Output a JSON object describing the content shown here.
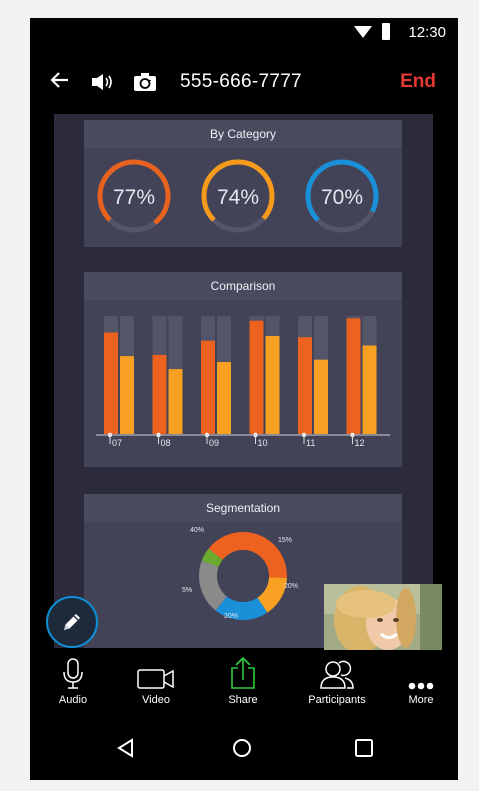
{
  "status": {
    "time": "12:30"
  },
  "call": {
    "phone_number": "555-666-7777",
    "end_label": "End"
  },
  "cards": {
    "category": {
      "title": "By Category",
      "gauges": [
        {
          "label": "77%",
          "value": 77,
          "color": "#e8621f"
        },
        {
          "label": "74%",
          "value": 74,
          "color": "#f59a1b"
        },
        {
          "label": "70%",
          "value": 70,
          "color": "#1a90d9"
        }
      ]
    },
    "comparison": {
      "title": "Comparison"
    },
    "segmentation": {
      "title": "Segmentation"
    }
  },
  "chart_data": [
    {
      "type": "bar",
      "title": "Comparison",
      "categories": [
        "07",
        "08",
        "09",
        "10",
        "11",
        "12"
      ],
      "series": [
        {
          "values": [
            86,
            67,
            79,
            96,
            82,
            98
          ],
          "color": "#ee6220"
        },
        {
          "values": [
            66,
            55,
            61,
            83,
            63,
            75
          ],
          "color": "#f7a021"
        }
      ],
      "ylim": [
        0,
        100
      ]
    },
    {
      "type": "pie",
      "title": "Segmentation",
      "labels": [
        "40%",
        "15%",
        "20%",
        "20%",
        "5%"
      ],
      "values": [
        40,
        15,
        20,
        20,
        5
      ],
      "colors": [
        "#ee6220",
        "#f7a021",
        "#1a90d9",
        "#8a8a8a",
        "#6aab2e"
      ]
    }
  ],
  "toolbar": {
    "audio": "Audio",
    "video": "Video",
    "share": "Share",
    "participants": "Participants",
    "more": "More"
  },
  "icons": {
    "back": "arrow-left-icon",
    "speaker": "speaker-icon",
    "camera": "camera-flip-icon",
    "pen": "pen-icon"
  }
}
